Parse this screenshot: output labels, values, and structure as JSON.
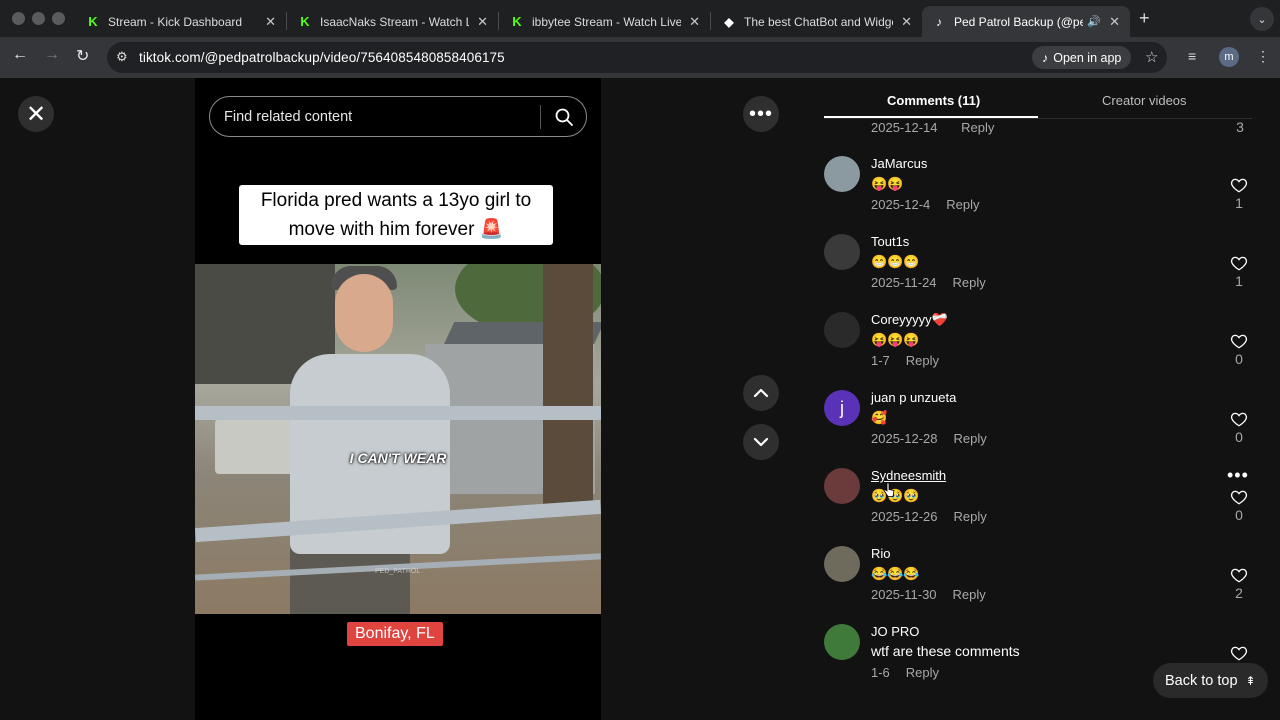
{
  "browser": {
    "tabs": [
      {
        "title": "Stream - Kick Dashboard",
        "favicon": "kick-icon"
      },
      {
        "title": "IsaacNaks Stream - Watch Live",
        "favicon": "kick-icon"
      },
      {
        "title": "ibbytee Stream - Watch Live",
        "favicon": "kick-icon"
      },
      {
        "title": "The best ChatBot and Widget",
        "favicon": "diamond-icon"
      },
      {
        "title": "Ped Patrol Backup (@pedp",
        "favicon": "tiktok-icon",
        "active": true
      }
    ],
    "url": "tiktok.com/@pedpatrolbackup/video/7564085480858406175",
    "open_in_app": "Open in app",
    "profile_initial": "m",
    "colors": {
      "tabbar": "#1f2022",
      "toolbar": "#35363a",
      "kick": "#53fc18"
    }
  },
  "video": {
    "search_placeholder": "Find related content",
    "caption": "Florida pred wants a 13yo girl to move with him forever 🚨",
    "subtitle": "I CAN'T WEAR",
    "watermark": "PED_PATROL",
    "location": "Bonifay, FL"
  },
  "panel": {
    "tab_comments": "Comments (11)",
    "tab_creator": "Creator videos",
    "partial_comment": {
      "date": "2025-12-14",
      "reply": "Reply",
      "likes": "3"
    },
    "comments": [
      {
        "name": "JaMarcus",
        "text": "😝😝",
        "date": "2025-12-4",
        "reply": "Reply",
        "likes": "1",
        "avatar_color": "#8a9aa0"
      },
      {
        "name": "Tout1s",
        "text": "😁😁😁",
        "date": "2025-11-24",
        "reply": "Reply",
        "likes": "1",
        "avatar_color": "#3a3a3a"
      },
      {
        "name": "Coreyyyyy❤️‍🩹",
        "text": "😝😝😝",
        "date": "1-7",
        "reply": "Reply",
        "likes": "0",
        "avatar_color": "#2a2a2a"
      },
      {
        "name": "juan p unzueta",
        "text": "🥰",
        "date": "2025-12-28",
        "reply": "Reply",
        "likes": "0",
        "avatar_color": "#5a32b8",
        "initial": "j"
      },
      {
        "name": "Sydneesmith",
        "text": "🥹🥹🥹",
        "date": "2025-12-26",
        "reply": "Reply",
        "likes": "0",
        "avatar_color": "#6b3a3a"
      },
      {
        "name": "Rio",
        "text": "😂😂😂",
        "date": "2025-11-30",
        "reply": "Reply",
        "likes": "2",
        "avatar_color": "#6e6a5c"
      },
      {
        "name": "JO PRO",
        "text": "wtf are these comments",
        "date": "1-6",
        "reply": "Reply",
        "likes": "",
        "avatar_color": "#3f7a3a"
      }
    ],
    "back_to_top": "Back to top"
  }
}
